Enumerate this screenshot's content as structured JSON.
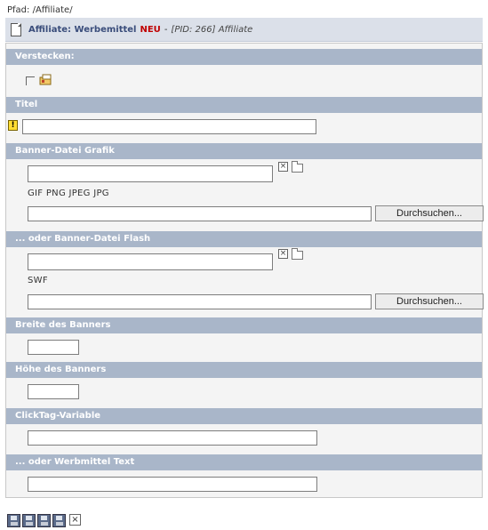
{
  "breadcrumb": "Pfad: /Affiliate/",
  "header": {
    "title": "Affiliate: Werbemittel",
    "badge": "NEU",
    "separator": "-",
    "pid": "[PID: 266] Affiliate"
  },
  "sections": {
    "hide": "Verstecken:",
    "title": "Titel",
    "banner_graphic": "Banner-Datei Grafik",
    "banner_flash": "... oder Banner-Datei Flash",
    "banner_width": "Breite des Banners",
    "banner_height": "Höhe des Banners",
    "clicktag": "ClickTag-Variable",
    "text": "... oder Werbmittel Text"
  },
  "fields": {
    "graphic_types": "GIF PNG JPEG JPG",
    "flash_types": "SWF",
    "browse_label": "Durchsuchen..."
  },
  "icons": {
    "x_glyph": "×"
  }
}
